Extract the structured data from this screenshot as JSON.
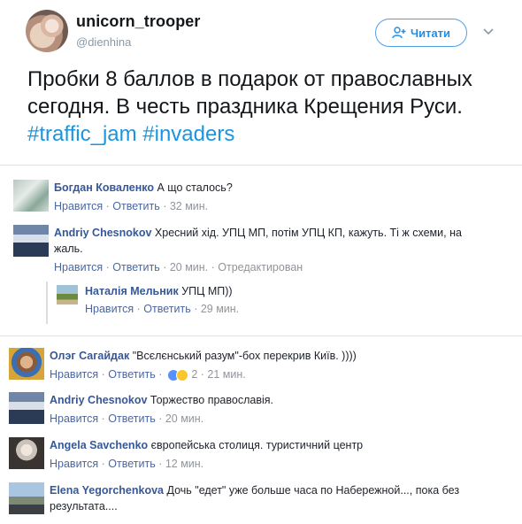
{
  "tweet": {
    "display_name": "unicorn_trooper",
    "handle": "@dienhina",
    "follow_label": "Читати",
    "text_plain": "Пробки 8 баллов в подарок от православных сегодня. В честь праздника Крещения Руси.",
    "hashtags": [
      "#traffic_jam",
      "#invaders"
    ]
  },
  "actions": {
    "like": "Нравится",
    "reply": "Ответить"
  },
  "comments": [
    {
      "author": "Богдан Коваленко",
      "text": "А що сталось?",
      "time": "32 мин."
    },
    {
      "author": "Andriy Chesnokov",
      "text": "Хресний хід. УПЦ МП, потім УПЦ КП, кажуть. Ті ж схеми, на жаль.",
      "time": "20 мин.",
      "edited": "Отредактирован"
    },
    {
      "author": "Наталія Мельник",
      "text": "УПЦ МП))",
      "time": "29 мин."
    },
    {
      "author": "Олэг Сагайдак",
      "text": "\"Всєлєнський разум\"-бох перекрив Київ. ))))",
      "reactions_count": "2",
      "time": "21 мин."
    },
    {
      "author": "Andriy Chesnokov",
      "text": "Торжество православія.",
      "time": "20 мин."
    },
    {
      "author": "Angela Savchenko",
      "text": "європейська столиця. туристичний центр",
      "time": "12 мин."
    },
    {
      "author": "Elena Yegorchenkova",
      "text": "Дочь \"едет\" уже больше часа по Набережной..., пока без результата...."
    }
  ],
  "colors": {
    "twitter_blue": "#1b95e0",
    "fb_name": "#365899",
    "fb_meta": "#90949c"
  }
}
